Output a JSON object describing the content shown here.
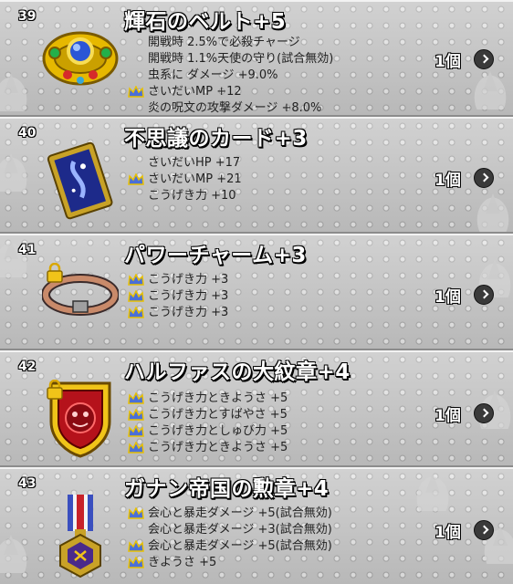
{
  "items": [
    {
      "number": "39",
      "name": "輝石のベルト+5",
      "icon": "jeweled-belt-icon",
      "locked": false,
      "stats": [
        {
          "text": "開戦時 2.5%で必殺チャージ",
          "crown": false
        },
        {
          "text": "開戦時 1.1%天使の守り(試合無効)",
          "crown": false
        },
        {
          "text": "虫系に ダメージ +9.0%",
          "crown": false
        },
        {
          "text": "さいだいMP +12",
          "crown": true
        },
        {
          "text": "炎の呪文の攻撃ダメージ +8.0%",
          "crown": false
        }
      ],
      "quantity": "1個"
    },
    {
      "number": "40",
      "name": "不思議のカード+3",
      "icon": "mystery-card-icon",
      "locked": false,
      "stats": [
        {
          "text": "さいだいHP +17",
          "crown": false
        },
        {
          "text": "さいだいMP +21",
          "crown": true
        },
        {
          "text": "こうげき力 +10",
          "crown": false
        }
      ],
      "quantity": "1個"
    },
    {
      "number": "41",
      "name": "パワーチャーム+3",
      "icon": "power-charm-ring-icon",
      "locked": true,
      "stats": [
        {
          "text": "こうげき力 +3",
          "crown": true
        },
        {
          "text": "こうげき力 +3",
          "crown": true
        },
        {
          "text": "こうげき力 +3",
          "crown": true
        }
      ],
      "quantity": "1個"
    },
    {
      "number": "42",
      "name": "ハルファスの大紋章+4",
      "icon": "halphas-crest-icon",
      "locked": true,
      "stats": [
        {
          "text": "こうげき力ときようさ +5",
          "crown": true
        },
        {
          "text": "こうげき力とすばやさ +5",
          "crown": true
        },
        {
          "text": "こうげき力としゅび力 +5",
          "crown": true
        },
        {
          "text": "こうげき力ときようさ +5",
          "crown": true
        }
      ],
      "quantity": "1個"
    },
    {
      "number": "43",
      "name": "ガナン帝国の勲章+4",
      "icon": "ganan-empire-medal-icon",
      "locked": false,
      "stats": [
        {
          "text": "会心と暴走ダメージ +5(試合無効)",
          "crown": true
        },
        {
          "text": "会心と暴走ダメージ +3(試合無効)",
          "crown": false
        },
        {
          "text": "会心と暴走ダメージ +5(試合無効)",
          "crown": true
        },
        {
          "text": "きようさ +5",
          "crown": true
        }
      ],
      "quantity": "1個"
    }
  ],
  "colors": {
    "background": "#c2c2c2",
    "crown": "#4a6fd8",
    "lock": "#f0c419",
    "arrow_button": "#3a3a3a"
  }
}
